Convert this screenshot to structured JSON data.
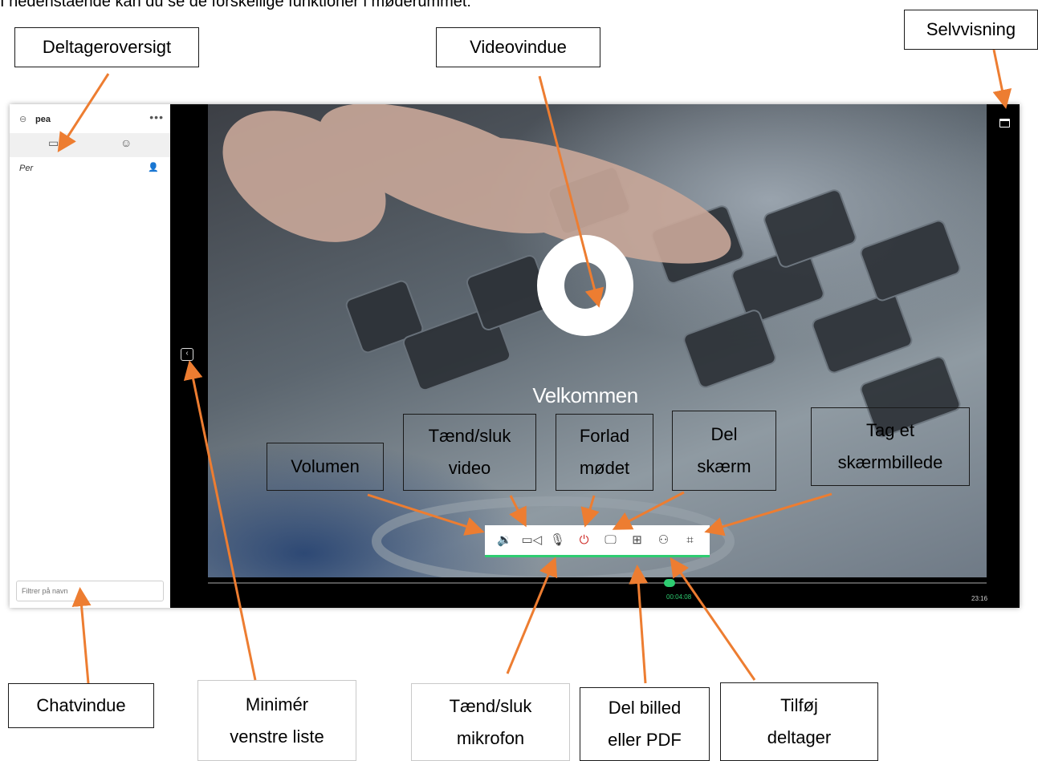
{
  "intro_text": "I nedenstående kan du se de forskellige funktioner i møderummet:",
  "labels": {
    "deltageroversigt": "Deltageroversigt",
    "videovindue": "Videovindue",
    "selvvisning": "Selvvisning",
    "volumen": "Volumen",
    "taend_sluk_video": "Tænd/sluk\nvideo",
    "forlad_modet": "Forlad\nmødet",
    "del_skaerm": "Del\nskærm",
    "tag_skaermbillede": "Tag et\nskærmbillede",
    "chatvindue": "Chatvindue",
    "minimer_venstre_liste": "Minimér\nvenstre liste",
    "taend_sluk_mikrofon": "Tænd/sluk\nmikrofon",
    "del_billed_pdf": "Del billed\neller PDF",
    "tilfoej_deltager": "Tilføj\ndeltager"
  },
  "sidebar": {
    "room_name": "pea",
    "participant": "Per",
    "filter_placeholder": "Filtrer på navn"
  },
  "video": {
    "welcome": "Velkommen",
    "time_current": "00:04:08",
    "time_total": "23:16"
  },
  "icons": {
    "link": "link-icon",
    "more": "more-dots-icon",
    "chat_tab": "chat-bubble-icon",
    "participants_tab": "participants-icon",
    "volume": "speaker-icon",
    "video": "video-camera-icon",
    "mic": "microphone-icon",
    "leave": "power-icon",
    "share_screen": "monitor-icon",
    "share_file": "file-plus-icon",
    "add_participant": "add-user-icon",
    "screenshot": "crop-icon",
    "self_view": "window-icon",
    "collapse": "collapse-panel-icon"
  },
  "colors": {
    "arrow": "#ed7d31",
    "accent_green": "#2ecc71",
    "leave_red": "#d0312d"
  }
}
